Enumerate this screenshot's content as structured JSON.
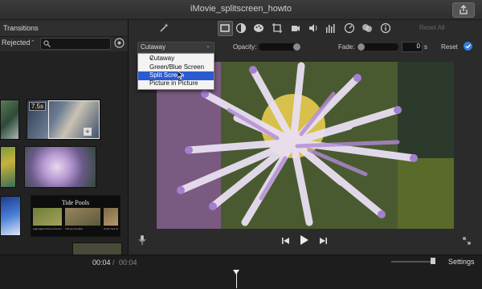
{
  "window": {
    "title": "iMovie_splitscreen_howto"
  },
  "browser": {
    "header_label": "Transitions",
    "filter_value": "Rejected",
    "search_placeholder": "",
    "clip_durations": [
      "7.5s"
    ],
    "tide_pools_title": "Tide Pools",
    "tide_pools_captions": [
      "Aggregated Green Anemone",
      "Tidepool Sculpin",
      "Ochre Sea Star"
    ]
  },
  "toolbar": {
    "icons": [
      "magic-wand-icon",
      "crop-frame-icon",
      "color-balance-icon",
      "color-palette-icon",
      "crop-icon",
      "camera-icon",
      "volume-icon",
      "equalizer-icon",
      "speedometer-icon",
      "filter-icon",
      "info-icon"
    ],
    "reset_all_label": "Reset All"
  },
  "overlay": {
    "style_selected": "Cutaway",
    "opacity_label": "Opacity:",
    "fade_label": "Fade:",
    "fade_value": "0",
    "fade_unit": "s",
    "reset_label": "Reset",
    "options": [
      "Cutaway",
      "Green/Blue Screen",
      "Split Screen",
      "Picture in Picture"
    ],
    "highlighted_option": "Split Screen",
    "fade_level": 0.02,
    "opacity_level": 1.0
  },
  "timeline": {
    "current_time": "00:04",
    "separator": "/",
    "total_time": "00:04",
    "settings_label": "Settings"
  },
  "colors": {
    "accent": "#2e7ee0",
    "menu_highlight": "#2a5bd0"
  }
}
